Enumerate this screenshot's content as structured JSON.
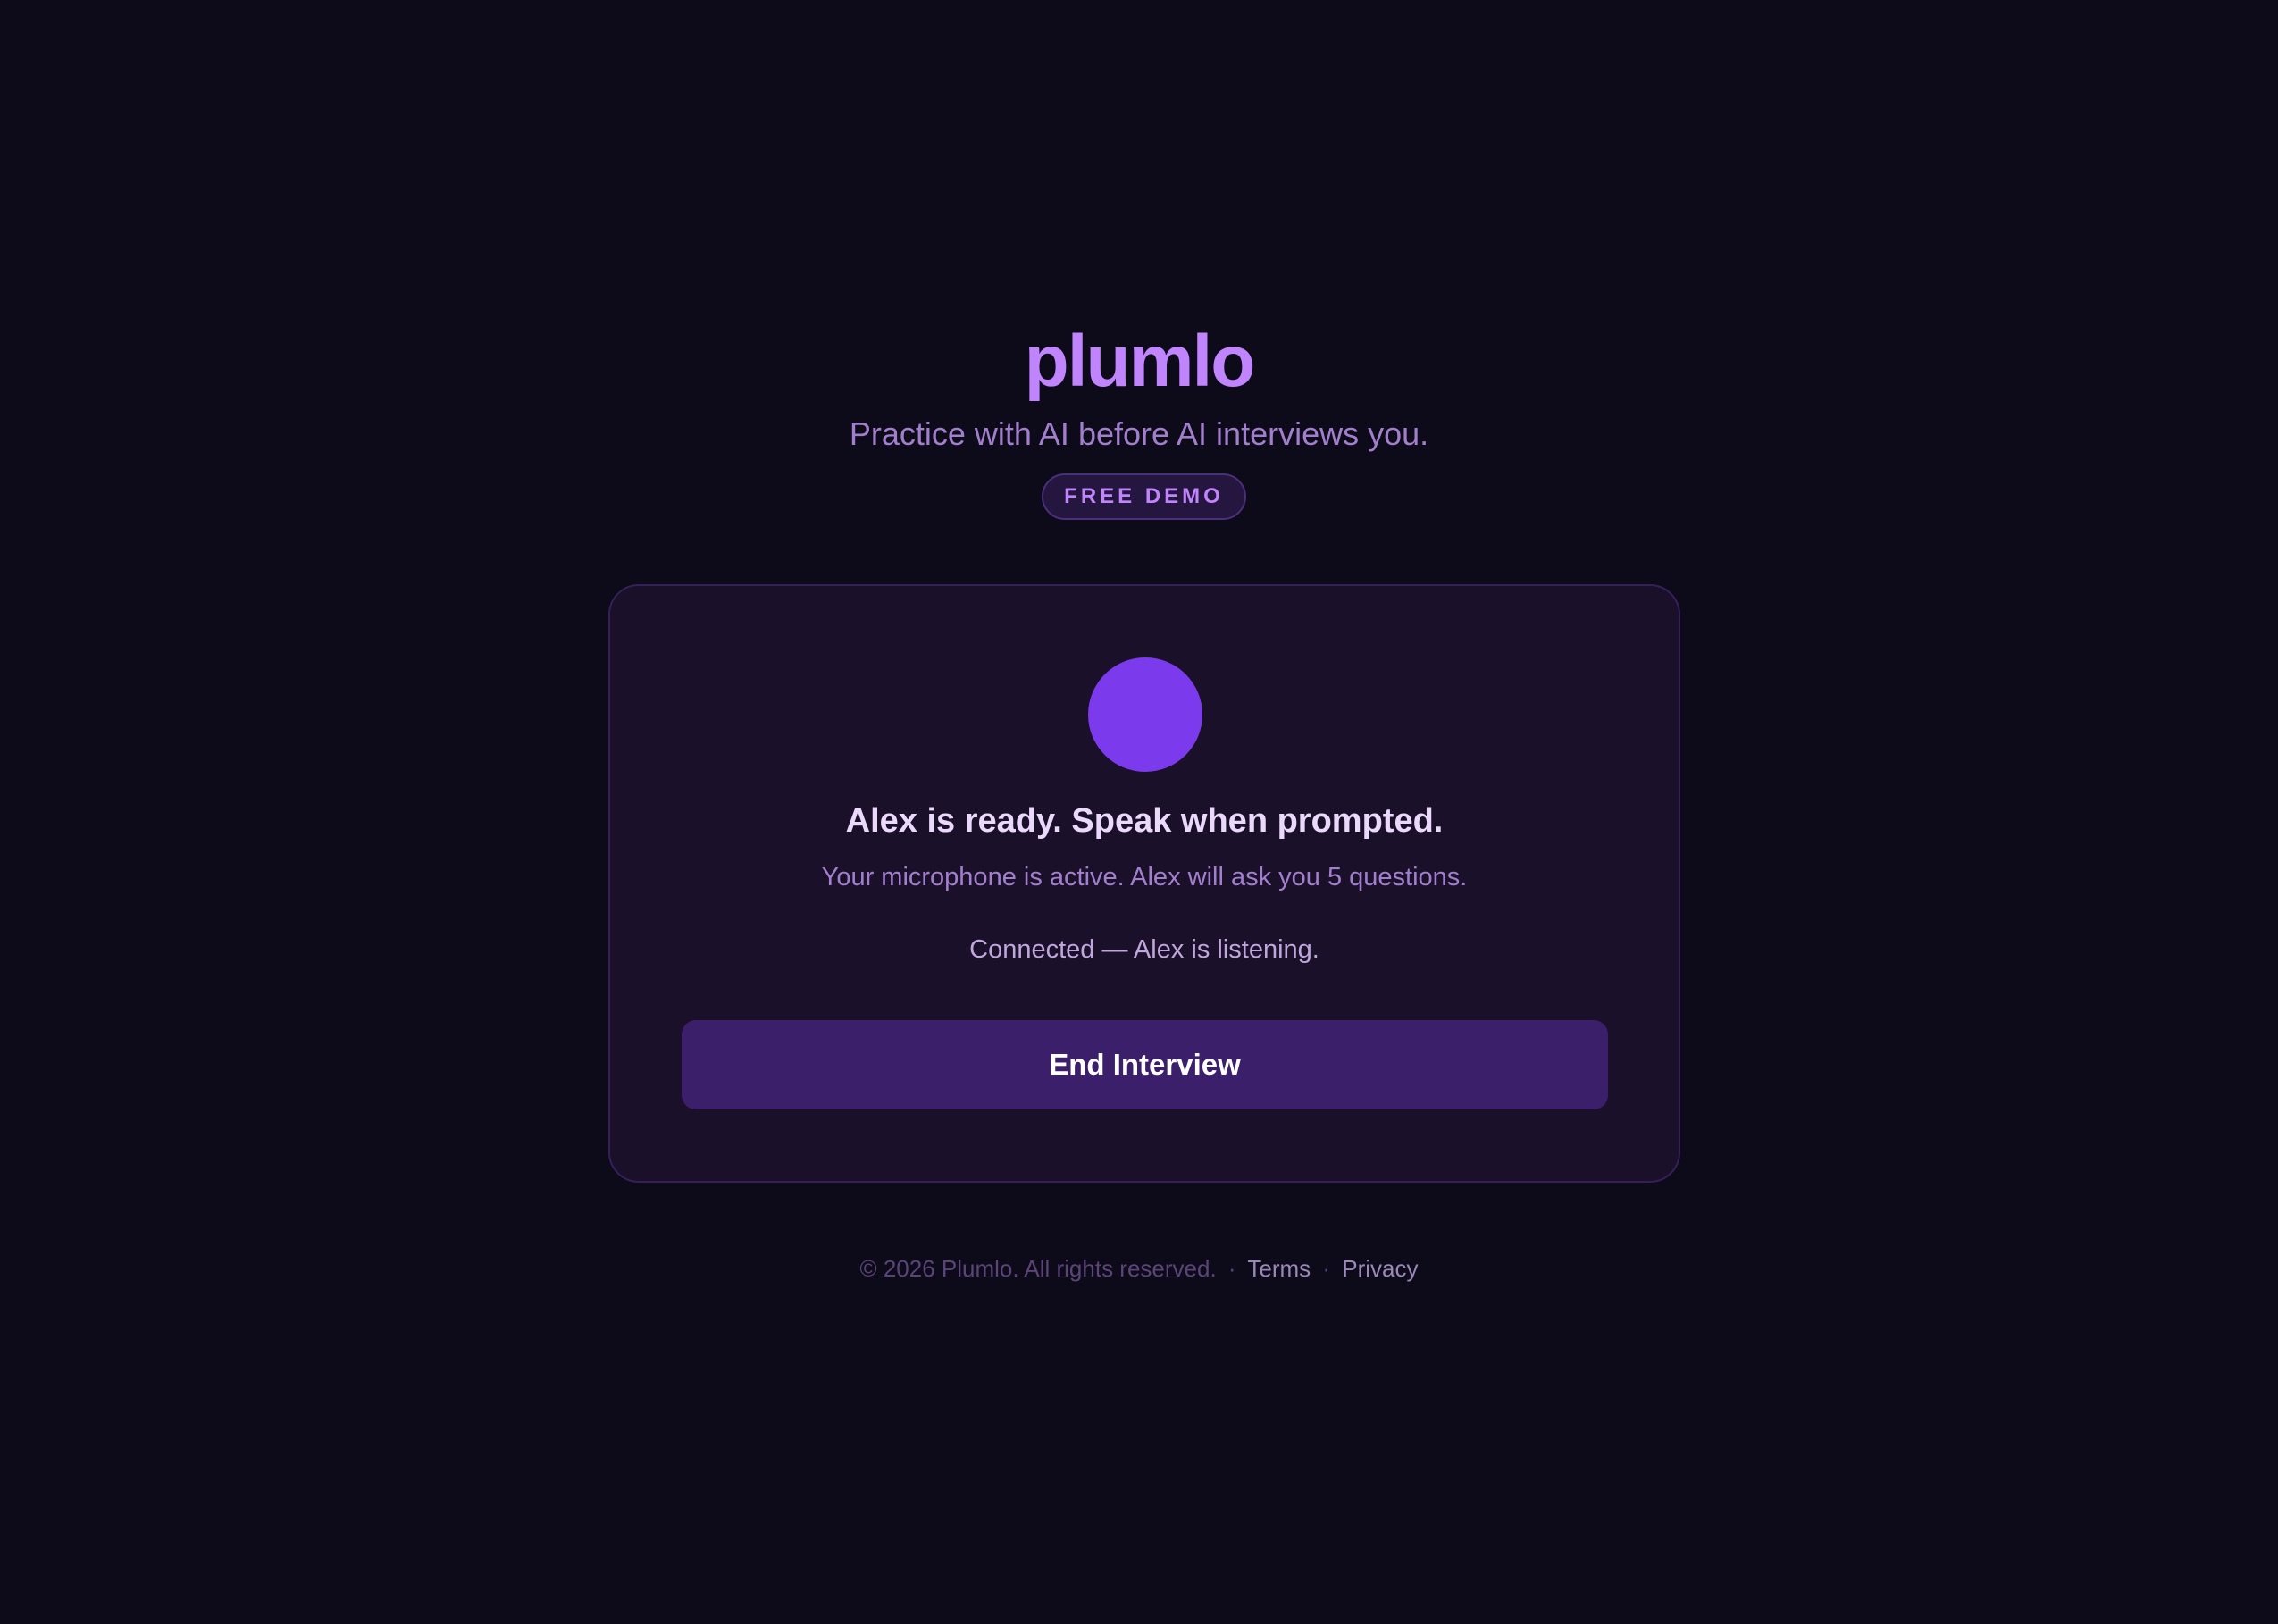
{
  "header": {
    "brand": "plumlo",
    "tagline": "Practice with AI before AI interviews you.",
    "badge": "FREE DEMO"
  },
  "card": {
    "title": "Alex is ready. Speak when prompted.",
    "subtitle": "Your microphone is active. Alex will ask you 5 questions.",
    "status": "Connected — Alex is listening.",
    "end_button_label": "End Interview"
  },
  "footer": {
    "copyright": "© 2026 Plumlo. All rights reserved.",
    "separator": "·",
    "links": [
      "Terms",
      "Privacy"
    ]
  },
  "colors": {
    "background": "#0d0a19",
    "accent": "#c084fc",
    "avatar": "#7c3aed",
    "card": "#1a1029",
    "button": "#3b1f6b"
  }
}
